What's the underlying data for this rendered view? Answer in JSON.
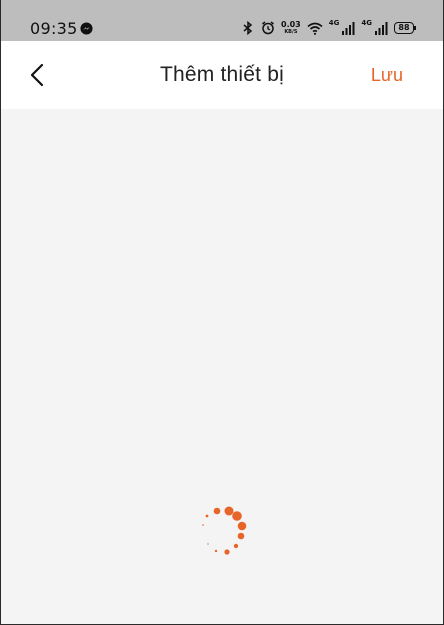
{
  "status_bar": {
    "time": "09:35",
    "net_speed_value": "0.03",
    "net_speed_unit": "KB/S",
    "network_1": "4G",
    "network_2": "4G",
    "battery": "88"
  },
  "header": {
    "title": "Thêm thiết bị",
    "save_label": "Lưu"
  },
  "colors": {
    "accent": "#e8652a",
    "status_bar_bg": "#bdbdbd",
    "content_bg": "#f4f4f4"
  },
  "icons": [
    "messenger-icon",
    "bluetooth-icon",
    "alarm-icon",
    "wifi-icon",
    "signal-icon",
    "battery-icon",
    "back-arrow-icon",
    "loading-spinner"
  ]
}
